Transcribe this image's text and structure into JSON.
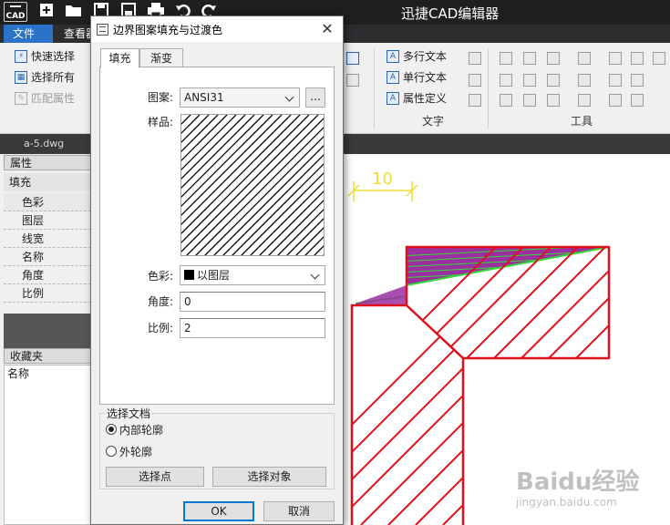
{
  "titlebar": {
    "app_icon_text": "CAD",
    "title": "迅捷CAD编辑器",
    "quick_access": [
      "new-icon",
      "open-icon",
      "save-icon",
      "save-as-icon",
      "print-icon",
      "undo-icon",
      "redo-icon"
    ]
  },
  "menubar": {
    "items": [
      "文件",
      "查看器"
    ]
  },
  "ribbon": {
    "select_buttons": [
      {
        "label": "快速选择",
        "icon": "quick-select-icon",
        "enabled": true
      },
      {
        "label": "选择所有",
        "icon": "select-all-icon",
        "enabled": true
      },
      {
        "label": "匹配属性",
        "icon": "match-properties-icon",
        "enabled": false
      }
    ],
    "text_buttons": [
      {
        "label": "多行文本",
        "icon": "mtext-icon"
      },
      {
        "label": "单行文本",
        "icon": "text-icon"
      },
      {
        "label": "属性定义",
        "icon": "attribute-definition-icon"
      }
    ],
    "group_text": "文字",
    "group_tools": "工具"
  },
  "doc_tab": "a-5.dwg",
  "properties_panel": {
    "header": "属性",
    "fill_label": "填充",
    "rows": [
      "色彩",
      "图层",
      "线宽",
      "名称",
      "角度",
      "比例"
    ]
  },
  "favorites_panel": {
    "header": "收藏夹",
    "name_label": "名称"
  },
  "drawing": {
    "dimension_text": "10",
    "hatch_color": "#e0101a",
    "dimension_color": "#ece030",
    "gradient_colors": [
      "#9a2fa0",
      "#36d83a"
    ]
  },
  "dialog": {
    "title": "边界图案填充与过渡色",
    "close_glyph": "✕",
    "tabs": [
      "填充",
      "渐变"
    ],
    "pattern_label": "图案:",
    "pattern_value": "ANSI31",
    "browse_label": "...",
    "sample_label": "样品:",
    "color_label": "色彩:",
    "color_value": "以图层",
    "angle_label": "角度:",
    "angle_value": "0",
    "scale_label": "比例:",
    "scale_value": "2",
    "group_title": "选择文档",
    "radio_inner": "内部轮廓",
    "radio_outer": "外轮廓",
    "pick_points": "选择点",
    "select_objects": "选择对象",
    "ok": "OK",
    "cancel": "取消"
  },
  "watermark": {
    "brand": "Baidu经验",
    "url": "jingyan.baidu.com"
  }
}
